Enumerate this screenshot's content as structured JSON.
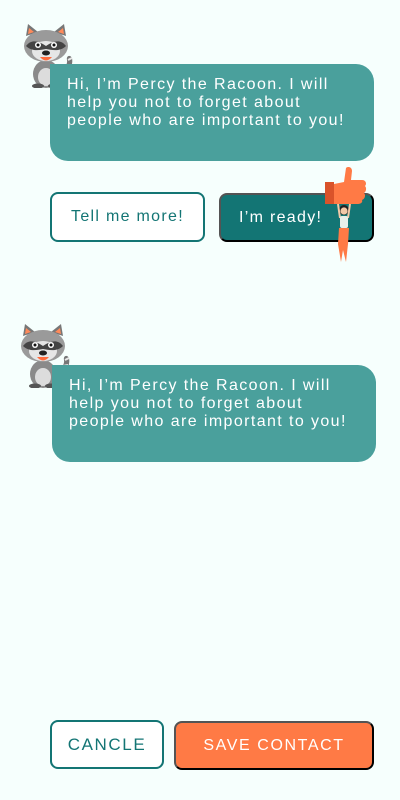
{
  "chat": {
    "messages": [
      {
        "sender": "raccoon-mascot",
        "text": "Hi, I’m Percy the Racoon. I will help you not to forget about people who are important to you!"
      },
      {
        "sender": "raccoon-mascot",
        "text": "Hi, I’m Percy the Racoon. I will help you not to forget about people who are important to you!"
      }
    ]
  },
  "replies": {
    "more_label": "Tell me more!",
    "ready_label": "I’m ready!"
  },
  "footer": {
    "cancel_label": "CANCLE",
    "save_label": "SAVE CONTACT"
  },
  "colors": {
    "background": "#f6fffd",
    "bubble": "#4aa09c",
    "primary": "#137574",
    "accent": "#ff7a45"
  },
  "icons": {
    "mascot": "raccoon-icon",
    "decoration": "thumbs-up-icon"
  }
}
